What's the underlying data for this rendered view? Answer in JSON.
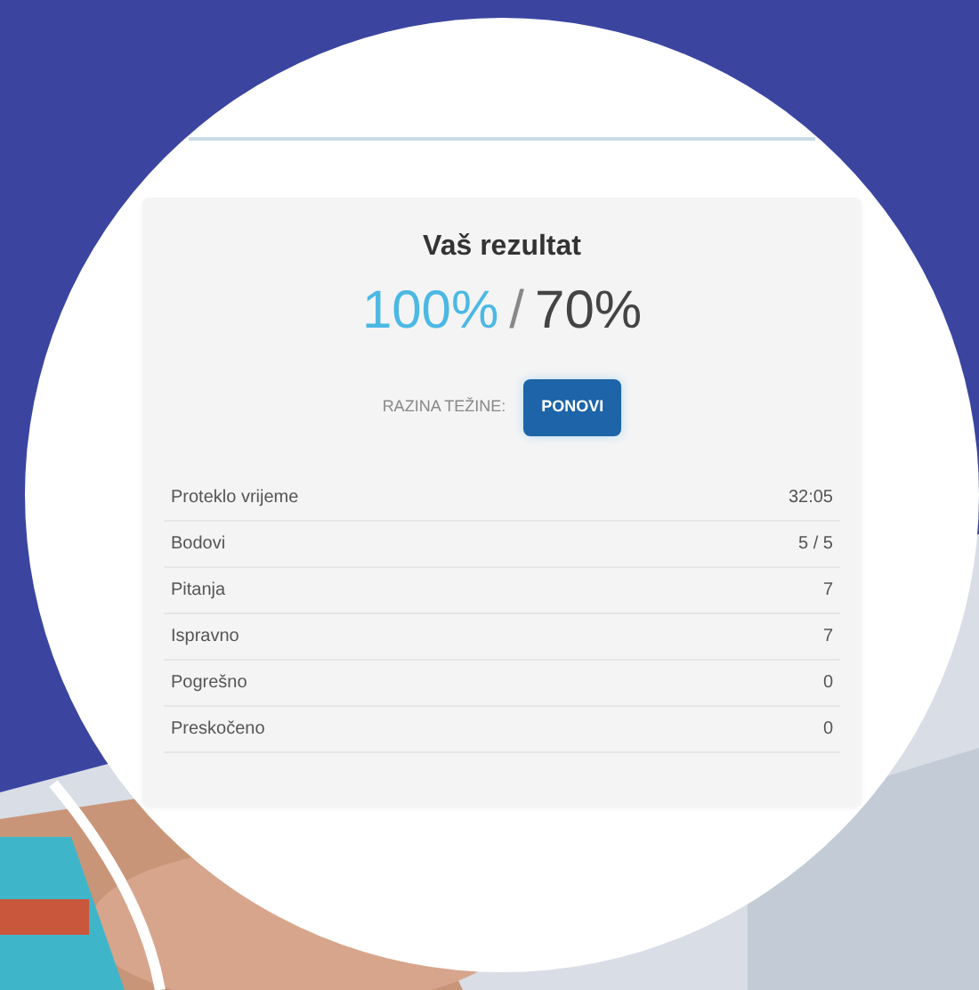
{
  "result": {
    "title": "Vaš rezultat",
    "score": "100%",
    "separator": "/",
    "pass_mark": "70%"
  },
  "difficulty": {
    "label": "RAZINA TEŽINE:",
    "button": "PONOVI"
  },
  "stats": [
    {
      "label": "Proteklo vrijeme",
      "value": "32:05"
    },
    {
      "label": "Bodovi",
      "value": "5 / 5"
    },
    {
      "label": "Pitanja",
      "value": "7"
    },
    {
      "label": "Ispravno",
      "value": "7"
    },
    {
      "label": "Pogrešno",
      "value": "0"
    },
    {
      "label": "Preskočeno",
      "value": "0"
    }
  ]
}
